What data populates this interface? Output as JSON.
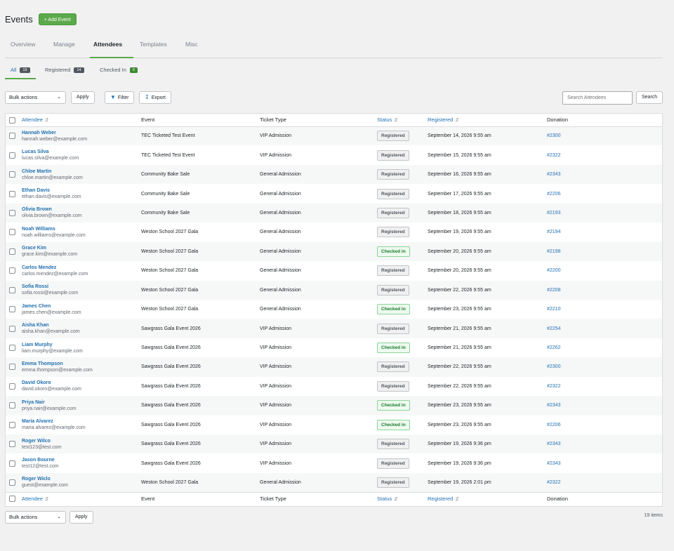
{
  "page": {
    "title": "Events",
    "add_button": "+ Add Event"
  },
  "tabs": [
    {
      "label": "Overview"
    },
    {
      "label": "Manage"
    },
    {
      "label": "Attendees"
    },
    {
      "label": "Templates"
    },
    {
      "label": "Misc"
    }
  ],
  "subtabs": {
    "all": {
      "label": "All",
      "count": "19"
    },
    "registered": {
      "label": "Registered",
      "count": "14"
    },
    "checked_in": {
      "label": "Checked In",
      "count": "6"
    }
  },
  "toolbar": {
    "bulk_actions": "Bulk actions",
    "apply": "Apply",
    "filter": "Filter",
    "export": "Export",
    "search_placeholder": "Search Attendees",
    "search": "Search"
  },
  "columns": {
    "attendee": "Attendee",
    "event": "Event",
    "ticket_type": "Ticket Type",
    "status": "Status",
    "registered": "Registered",
    "donation": "Donation"
  },
  "rows": [
    {
      "name": "Hannah Weber",
      "email": "hannah.weber@example.com",
      "event": "TEC Ticketed Test Event",
      "ticket": "VIP Admission",
      "status": "Registered",
      "registered": "September 14, 2026 9:55 am",
      "donation": "#2300"
    },
    {
      "name": "Lucas Silva",
      "email": "lucas.silva@example.com",
      "event": "TEC Ticketed Test Event",
      "ticket": "VIP Admission",
      "status": "Registered",
      "registered": "September 15, 2026 9:55 am",
      "donation": "#2322"
    },
    {
      "name": "Chloe Martin",
      "email": "chloe.martin@example.com",
      "event": "Community Bake Sale",
      "ticket": "General Admission",
      "status": "Registered",
      "registered": "September 16, 2026 9:55 am",
      "donation": "#2343"
    },
    {
      "name": "Ethan Davis",
      "email": "ethan.davis@example.com",
      "event": "Community Bake Sale",
      "ticket": "General Admission",
      "status": "Registered",
      "registered": "September 17, 2026 9:55 am",
      "donation": "#2206"
    },
    {
      "name": "Olivia Brown",
      "email": "olivia.brown@example.com",
      "event": "Community Bake Sale",
      "ticket": "General Admission",
      "status": "Registered",
      "registered": "September 18, 2026 9:55 am",
      "donation": "#2193"
    },
    {
      "name": "Noah Williams",
      "email": "noah.williams@example.com",
      "event": "Weston School 2027 Gala",
      "ticket": "General Admission",
      "status": "Registered",
      "registered": "September 19, 2026 9:55 am",
      "donation": "#2194"
    },
    {
      "name": "Grace Kim",
      "email": "grace.kim@example.com",
      "event": "Weston School 2027 Gala",
      "ticket": "General Admission",
      "status": "Checked in",
      "registered": "September 20, 2026 9:55 am",
      "donation": "#2198"
    },
    {
      "name": "Carlos Mendez",
      "email": "carlos.mendez@example.com",
      "event": "Weston School 2027 Gala",
      "ticket": "General Admission",
      "status": "Registered",
      "registered": "September 20, 2026 9:55 am",
      "donation": "#2200"
    },
    {
      "name": "Sofia Rossi",
      "email": "sofia.rossi@example.com",
      "event": "Weston School 2027 Gala",
      "ticket": "General Admission",
      "status": "Registered",
      "registered": "September 22, 2026 9:55 am",
      "donation": "#2208"
    },
    {
      "name": "James Chen",
      "email": "james.chen@example.com",
      "event": "Weston School 2027 Gala",
      "ticket": "General Admission",
      "status": "Checked in",
      "registered": "September 23, 2026 9:55 am",
      "donation": "#2210"
    },
    {
      "name": "Aisha Khan",
      "email": "aisha.khan@example.com",
      "event": "Sawgrass Gala Event 2026",
      "ticket": "VIP Admission",
      "status": "Registered",
      "registered": "September 21, 2026 9:55 am",
      "donation": "#2254"
    },
    {
      "name": "Liam Murphy",
      "email": "liam.murphy@example.com",
      "event": "Sawgrass Gala Event 2026",
      "ticket": "VIP Admission",
      "status": "Checked in",
      "registered": "September 21, 2026 9:55 am",
      "donation": "#2262"
    },
    {
      "name": "Emma Thompson",
      "email": "emma.thompson@example.com",
      "event": "Sawgrass Gala Event 2026",
      "ticket": "VIP Admission",
      "status": "Registered",
      "registered": "September 22, 2026 9:55 am",
      "donation": "#2300"
    },
    {
      "name": "David Okoro",
      "email": "david.okoro@example.com",
      "event": "Sawgrass Gala Event 2026",
      "ticket": "VIP Admission",
      "status": "Registered",
      "registered": "September 22, 2026 9:55 am",
      "donation": "#2322"
    },
    {
      "name": "Priya Nair",
      "email": "priya.nair@example.com",
      "event": "Sawgrass Gala Event 2026",
      "ticket": "VIP Admission",
      "status": "Checked in",
      "registered": "September 23, 2026 9:55 am",
      "donation": "#2343"
    },
    {
      "name": "Maria Alvarez",
      "email": "maria.alvarez@example.com",
      "event": "Sawgrass Gala Event 2026",
      "ticket": "VIP Admission",
      "status": "Checked in",
      "registered": "September 23, 2026 9:55 am",
      "donation": "#2206"
    },
    {
      "name": "Roger Wilco",
      "email": "test123@test.com",
      "event": "Sawgrass Gala Event 2026",
      "ticket": "VIP Admission",
      "status": "Registered",
      "registered": "September 19, 2026 9:36 pm",
      "donation": "#2343"
    },
    {
      "name": "Jason Bourne",
      "email": "test12@test.com",
      "event": "Sawgrass Gala Event 2026",
      "ticket": "VIP Admission",
      "status": "Registered",
      "registered": "September 19, 2026 9:36 pm",
      "donation": "#2343"
    },
    {
      "name": "Roger Wiclo",
      "email": "guest@example.com",
      "event": "Weston School 2027 Gala",
      "ticket": "General Admission",
      "status": "Registered",
      "registered": "September 19, 2026 2:01 pm",
      "donation": "#2322"
    }
  ],
  "footer": {
    "bulk_actions": "Bulk actions",
    "apply": "Apply",
    "items_count": "19 items"
  },
  "icons": {
    "sort": "sort-arrows-icon",
    "filter": "filter-icon",
    "export": "export-icon",
    "dropdown": "chevron-down-icon"
  },
  "colors": {
    "accent_green": "#5ba94a",
    "link_blue": "#2271b1",
    "checked_in_green": "#1a7a2b"
  }
}
